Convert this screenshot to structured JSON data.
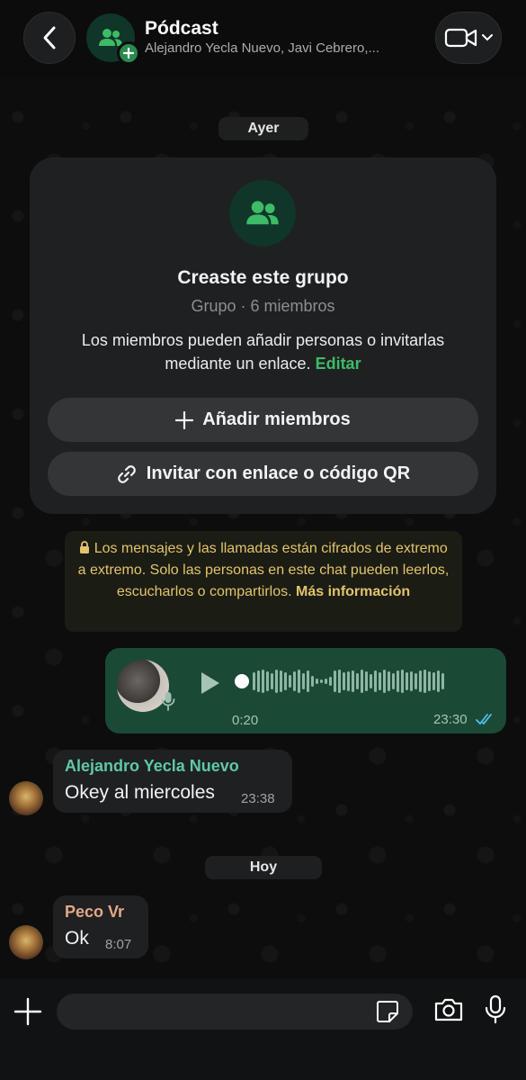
{
  "header": {
    "title": "Pódcast",
    "subtitle": "Alejandro Yecla Nuevo, Javi Cebrero,..."
  },
  "dates": {
    "yesterday": "Ayer",
    "today": "Hoy"
  },
  "system_card": {
    "title": "Creaste este grupo",
    "subtitle": "Grupo · 6 miembros",
    "description": "Los miembros pueden añadir personas o invitarlas mediante un enlace.",
    "edit_link": "Editar",
    "add_members_label": "Añadir miembros",
    "invite_label": "Invitar con enlace o código QR"
  },
  "encryption_notice": {
    "text": "Los mensajes y las llamadas están cifrados de extremo a extremo. Solo las personas en este chat pueden leerlos, escucharlos o compartirlos.",
    "link": "Más información"
  },
  "messages": [
    {
      "type": "voice",
      "outgoing": true,
      "duration": "0:20",
      "time": "23:30",
      "status": "read",
      "progress": 0.0
    },
    {
      "type": "text",
      "sender": "Alejandro Yecla Nuevo",
      "sender_color": "#5ec9a6",
      "text": "Okey al miercoles",
      "time": "23:38"
    },
    {
      "type": "text",
      "sender": "Peco Vr",
      "sender_color": "#e3a889",
      "text": "Ok",
      "time": "8:07"
    }
  ],
  "input": {
    "placeholder": ""
  },
  "colors": {
    "accent_green": "#3dbb67",
    "outgoing_bubble": "#1a4a35",
    "incoming_bubble": "#1f2021",
    "encryption_text": "#e3c46c",
    "read_ticks": "#53bdeb"
  },
  "icons": {
    "back": "chevron-left-icon",
    "group": "group-icon",
    "video": "video-camera-icon",
    "plus": "plus-icon",
    "link": "link-icon",
    "lock": "lock-icon",
    "play": "play-icon",
    "mic": "microphone-icon",
    "sticker": "sticker-icon",
    "camera": "camera-icon"
  }
}
